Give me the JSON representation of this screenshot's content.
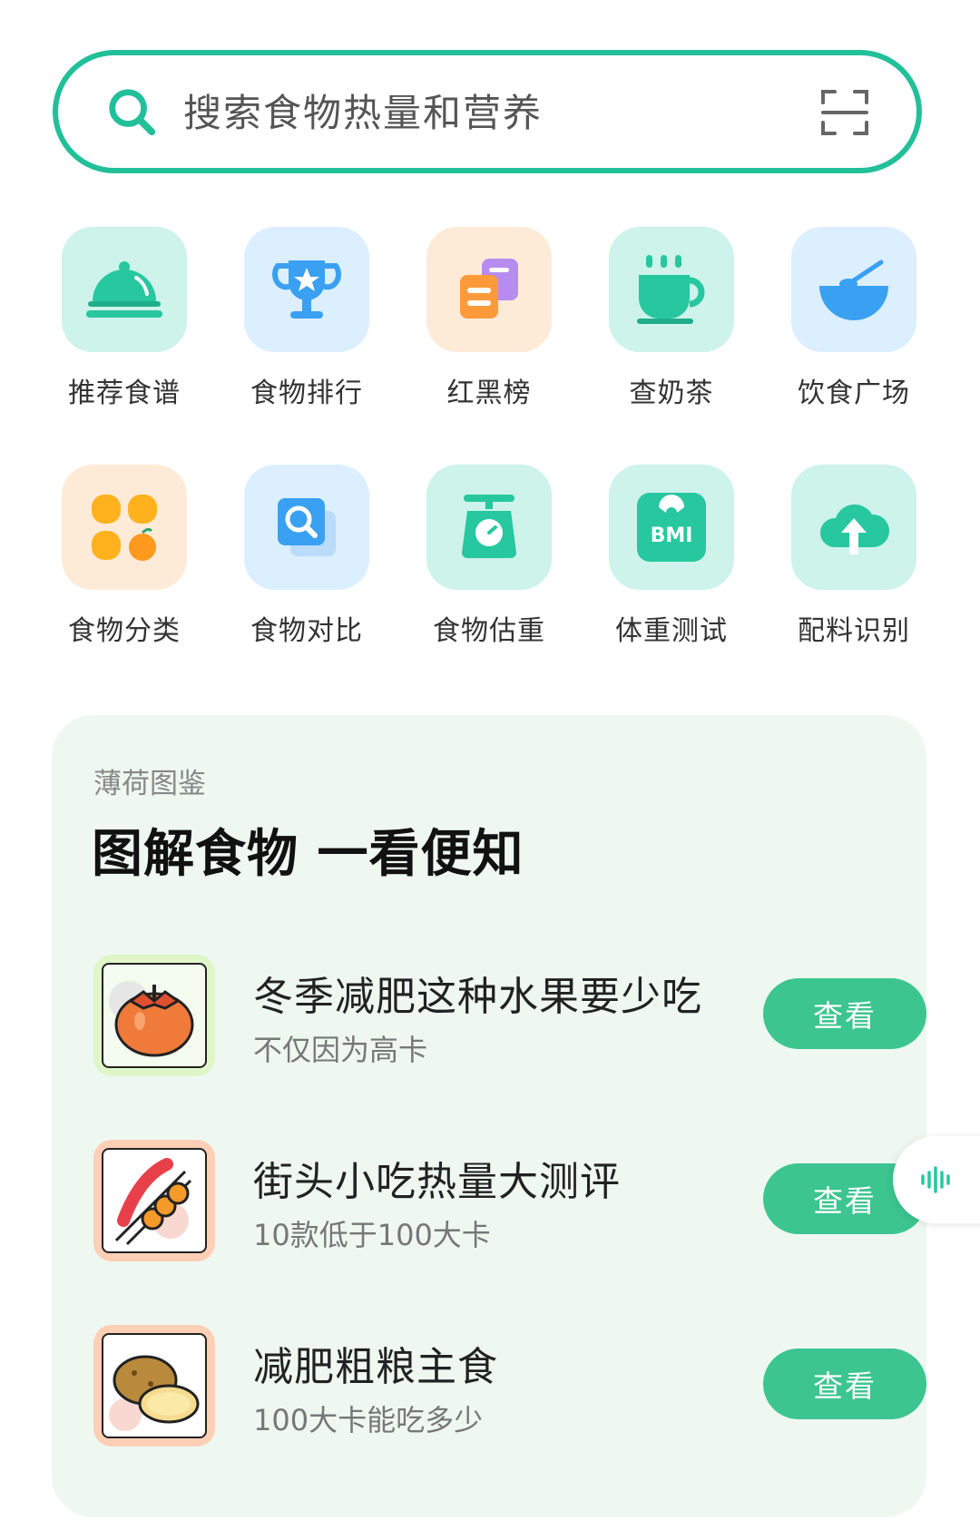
{
  "search": {
    "placeholder": "搜索食物热量和营养"
  },
  "grid": [
    {
      "label": "推荐食谱",
      "icon": "cloche-icon",
      "color": "#cdf3ea"
    },
    {
      "label": "食物排行",
      "icon": "trophy-icon",
      "color": "#dcefff"
    },
    {
      "label": "红黑榜",
      "icon": "cards-icon",
      "color": "#fdebd8"
    },
    {
      "label": "查奶茶",
      "icon": "cup-icon",
      "color": "#cdf3ea"
    },
    {
      "label": "饮食广场",
      "icon": "bowl-icon",
      "color": "#dcefff"
    },
    {
      "label": "食物分类",
      "icon": "categories-icon",
      "color": "#fdebd8"
    },
    {
      "label": "食物对比",
      "icon": "compare-search-icon",
      "color": "#dcefff"
    },
    {
      "label": "食物估重",
      "icon": "scale-icon",
      "color": "#cdf3ea"
    },
    {
      "label": "体重测试",
      "icon": "bmi-scale-icon",
      "color": "#cdf3ea"
    },
    {
      "label": "配料识别",
      "icon": "cloud-upload-icon",
      "color": "#cdf3ea"
    }
  ],
  "card": {
    "subtitle": "薄荷图鉴",
    "title": "图解食物 一看便知",
    "articles": [
      {
        "title": "冬季减肥这种水果要少吃",
        "desc": "不仅因为高卡",
        "button": "查看",
        "icon": "persimmon-icon"
      },
      {
        "title": "街头小吃热量大测评",
        "desc": "10款低于100大卡",
        "button": "查看",
        "icon": "skewer-icon"
      },
      {
        "title": "减肥粗粮主食",
        "desc": "100大卡能吃多少",
        "button": "查看",
        "icon": "potato-icon"
      }
    ]
  },
  "accent": "#22c09a",
  "button_color": "#3cc58f"
}
